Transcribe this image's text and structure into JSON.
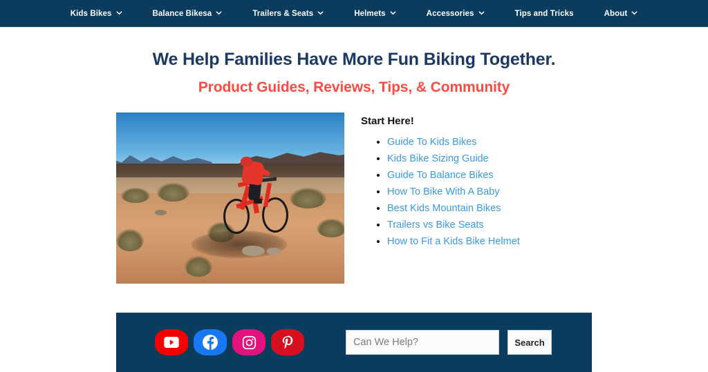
{
  "nav": {
    "items": [
      {
        "label": "Kids Bikes",
        "has_dropdown": true
      },
      {
        "label": "Balance Bikesa",
        "has_dropdown": true
      },
      {
        "label": "Trailers & Seats",
        "has_dropdown": true
      },
      {
        "label": "Helmets",
        "has_dropdown": true
      },
      {
        "label": "Accessories",
        "has_dropdown": true
      },
      {
        "label": "Tips and Tricks",
        "has_dropdown": false
      },
      {
        "label": "About",
        "has_dropdown": true
      }
    ]
  },
  "hero": {
    "headline": "We Help Families Have More Fun Biking Together.",
    "subheadline": "Product Guides, Reviews, Tips, & Community"
  },
  "main": {
    "photo_alt": "Child in red jersey riding a red mountain bike on a desert trail",
    "start_here_title": "Start Here!",
    "links": [
      "Guide To Kids Bikes",
      "Kids Bike Sizing Guide",
      "Guide To Balance Bikes",
      "How To Bike With A Baby",
      "Best Kids Mountain Bikes",
      "Trailers vs Bike Seats",
      "How to Fit a Kids Bike Helmet"
    ]
  },
  "footer": {
    "social": [
      {
        "name": "youtube",
        "color": "#f50000"
      },
      {
        "name": "facebook",
        "color": "#1877f2"
      },
      {
        "name": "instagram",
        "color": "#e5127d"
      },
      {
        "name": "pinterest",
        "color": "#d5101f"
      }
    ],
    "search": {
      "value": "",
      "placeholder": "Can We Help?",
      "button_label": "Search"
    }
  },
  "colors": {
    "navy": "#0b3c5d",
    "heading": "#1b3a63",
    "accent_red": "#fa4b42",
    "link_blue": "#3b9ae1"
  }
}
